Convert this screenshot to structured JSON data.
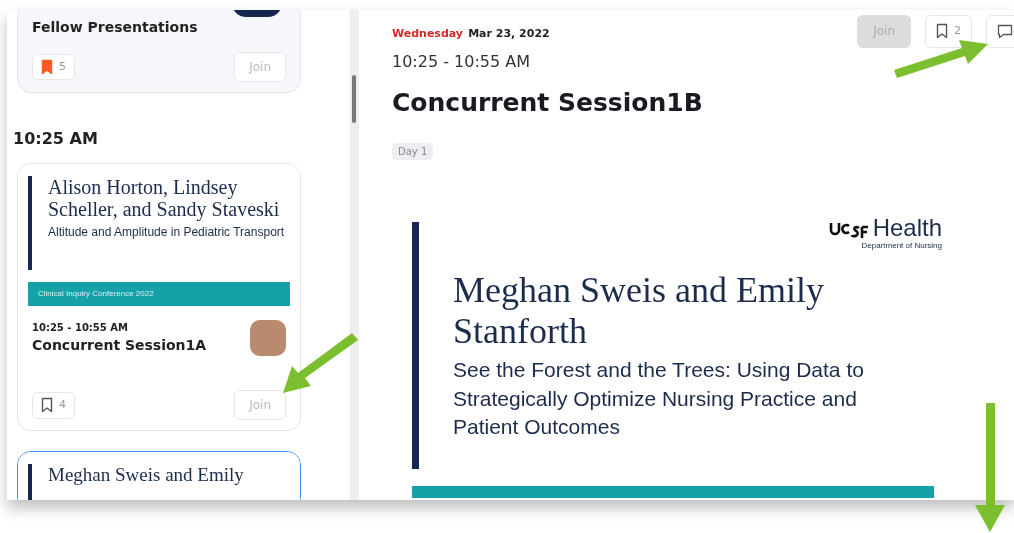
{
  "sidebar": {
    "items": [
      {
        "kind": "session",
        "selected": false,
        "title": "Fellow Presentations",
        "bookmarked": true,
        "bookmark_count": "5",
        "join": "Join"
      },
      {
        "kind": "time_header",
        "text": "10:25 AM"
      },
      {
        "kind": "session",
        "selected": false,
        "slide": {
          "names": "Alison Horton, Lindsey Scheller, and Sandy Staveski",
          "subtitle": "Altitude and Amplitude in Pediatric Transport",
          "band": "Clinical Inquiry Conference 2022"
        },
        "time": "10:25 - 10:55 AM",
        "title": "Concurrent Session1A",
        "bookmarked": false,
        "bookmark_count": "4",
        "join": "Join"
      },
      {
        "kind": "session",
        "selected": true,
        "slide": {
          "names": "Meghan Sweis and Emily"
        }
      }
    ]
  },
  "detail": {
    "weekday": "Wednesday",
    "date": "Mar 23, 2022",
    "time": "10:25 - 10:55 AM",
    "title": "Concurrent Session1B",
    "tag": "Day 1",
    "join": {
      "label": "Join",
      "disabled": true
    },
    "bookmarked": false,
    "bookmark_count": "2",
    "slide": {
      "logo": "Health",
      "logo_sub": "Department of Nursing",
      "names": "Meghan Sweis and Emily Stanforth",
      "subtitle": "See the Forest and the Trees: Using Data to Strategically Optimize Nursing Practice and Patient Outcomes"
    }
  }
}
